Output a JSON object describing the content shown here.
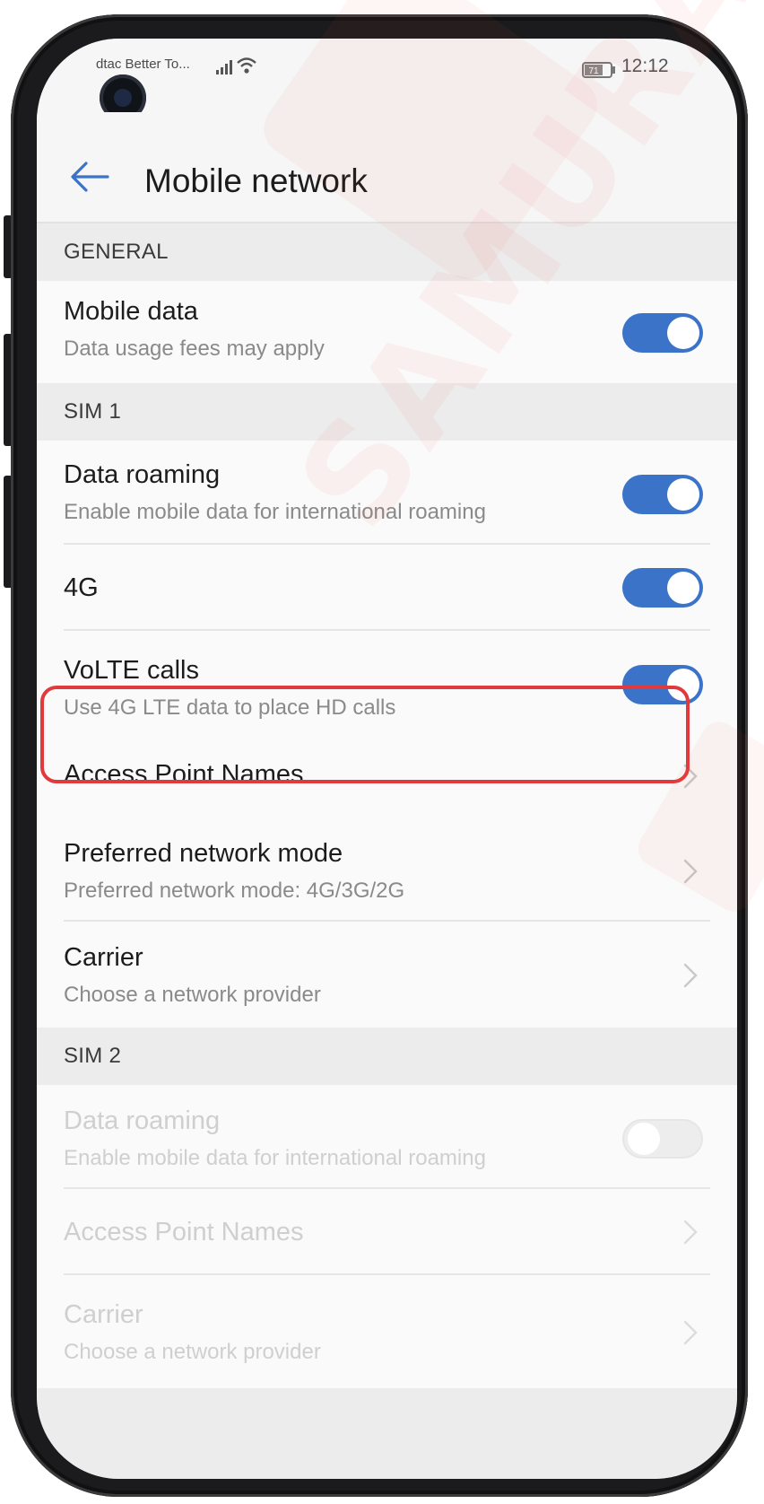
{
  "status_bar": {
    "carrier": "dtac Better To...",
    "battery": "71",
    "time": "12:12"
  },
  "header": {
    "back_icon": "arrow-left-icon",
    "title": "Mobile network"
  },
  "sections": {
    "general": {
      "header": "GENERAL",
      "mobile_data": {
        "title": "Mobile data",
        "subtitle": "Data usage fees may apply",
        "enabled": true
      }
    },
    "sim1": {
      "header": "SIM 1",
      "data_roaming": {
        "title": "Data roaming",
        "subtitle": "Enable mobile data for international roaming",
        "enabled": true
      },
      "four_g": {
        "title": "4G",
        "enabled": true
      },
      "volte": {
        "title": "VoLTE calls",
        "subtitle": "Use 4G LTE data to place HD calls",
        "enabled": true
      },
      "apn": {
        "title": "Access Point Names"
      },
      "preferred_mode": {
        "title": "Preferred network mode",
        "subtitle": "Preferred network mode: 4G/3G/2G"
      },
      "carrier": {
        "title": "Carrier",
        "subtitle": "Choose a network provider"
      }
    },
    "sim2": {
      "header": "SIM 2",
      "data_roaming": {
        "title": "Data roaming",
        "subtitle": "Enable mobile data for international roaming",
        "enabled": false
      },
      "apn": {
        "title": "Access Point Names"
      },
      "carrier": {
        "title": "Carrier",
        "subtitle": "Choose a network provider"
      }
    }
  },
  "colors": {
    "toggle_on": "#3a73c7",
    "highlight": "#e13a3e",
    "back_arrow": "#3a73c7"
  },
  "watermark": "SAMURAI SIM"
}
